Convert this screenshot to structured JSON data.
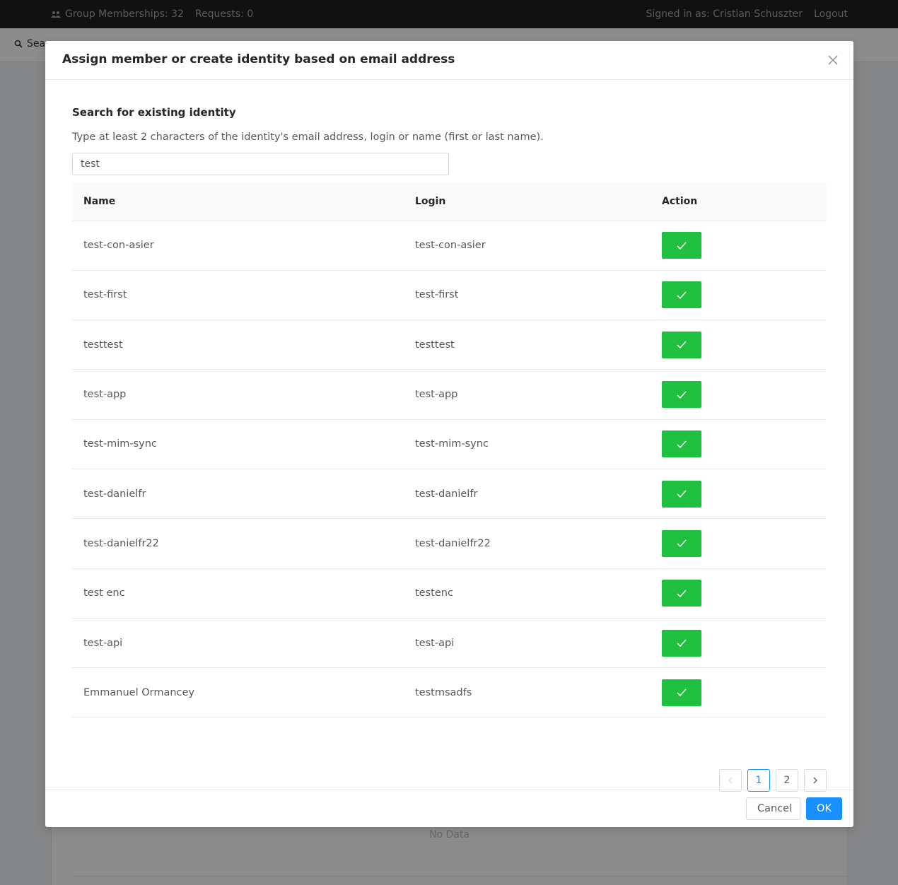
{
  "topbar": {
    "group_memberships": "Group Memberships: 32",
    "requests": "Requests: 0",
    "signed_in": "Signed in as: Cristian Schuszter",
    "logout": "Logout"
  },
  "subbar": {
    "search_label": "Sea"
  },
  "background": {
    "no_data": "No Data"
  },
  "modal": {
    "title": "Assign member or create identity based on email address",
    "section_title": "Search for existing identity",
    "hint": "Type at least 2 characters of the identity's email address, login or name (first or last name).",
    "search_value": "test",
    "columns": {
      "name": "Name",
      "login": "Login",
      "action": "Action"
    },
    "rows": [
      {
        "name": "test-con-asier",
        "login": "test-con-asier"
      },
      {
        "name": "test-first",
        "login": "test-first"
      },
      {
        "name": "testtest",
        "login": "testtest"
      },
      {
        "name": "test-app",
        "login": "test-app"
      },
      {
        "name": "test-mim-sync",
        "login": "test-mim-sync"
      },
      {
        "name": "test-danielfr",
        "login": "test-danielfr"
      },
      {
        "name": "test-danielfr22",
        "login": "test-danielfr22"
      },
      {
        "name": "test enc",
        "login": "testenc"
      },
      {
        "name": "test-api",
        "login": "test-api"
      },
      {
        "name": "Emmanuel Ormancey",
        "login": "testmsadfs"
      }
    ],
    "pagination": {
      "pages": [
        "1",
        "2"
      ],
      "current": "1"
    },
    "cancel_label": "Cancel",
    "ok_label": "OK"
  },
  "colors": {
    "select_green": "#1fbf3f",
    "primary": "#1890ff"
  }
}
